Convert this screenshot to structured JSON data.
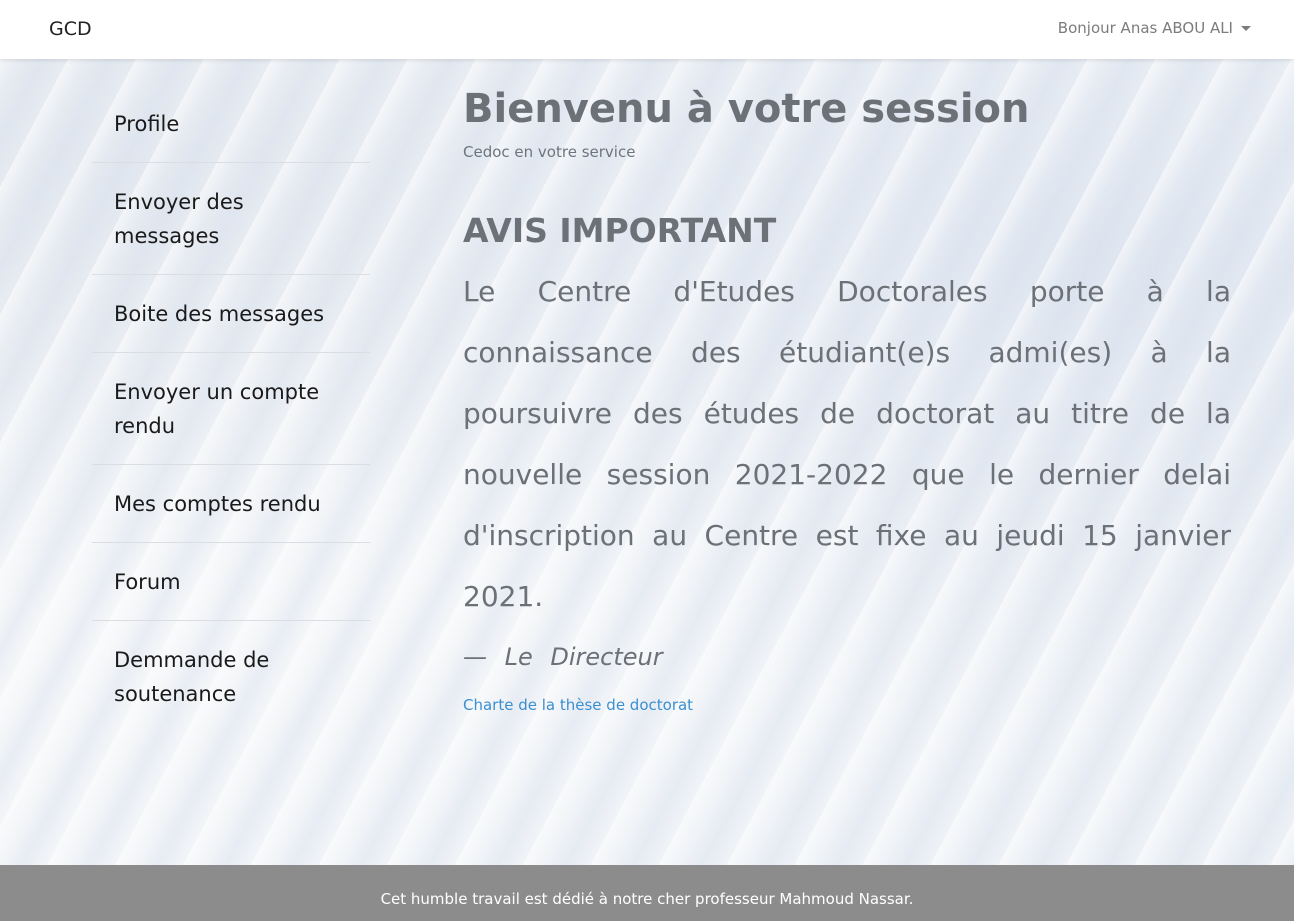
{
  "navbar": {
    "brand": "GCD",
    "user_greeting": "Bonjour Anas ABOU ALI",
    "user_menu_icon": "caret-down-icon"
  },
  "sidebar": {
    "items": [
      {
        "label": "Profile"
      },
      {
        "label": "Envoyer des messages"
      },
      {
        "label": "Boite des messages"
      },
      {
        "label": "Envoyer un compte rendu"
      },
      {
        "label": "Mes comptes rendu"
      },
      {
        "label": "Forum"
      },
      {
        "label": "Demmande de soutenance"
      }
    ]
  },
  "main": {
    "title": "Bienvenu à votre session",
    "subtitle": "Cedoc en votre service",
    "notice_title": "AVIS IMPORTANT",
    "notice_body": "Le Centre d'Etudes Doctorales porte à la connaissance des étudiant(e)s admi(es) à la poursuivre des études de doctorat au titre de la nouvelle session 2021-2022 que le dernier delai d'inscription au Centre est fixe au jeudi 15 janvier 2021.",
    "signature": "— Le Directeur",
    "charter_link": "Charte de la thèse de doctorat"
  },
  "footer": {
    "text": "Cet humble travail est dédié à notre cher professeur Mahmoud Nassar."
  },
  "colors": {
    "navbar_bg": "#ffffff",
    "footer_bg": "#8c8c8c",
    "link": "#3a8fd1",
    "heading_text": "#6b7177"
  }
}
